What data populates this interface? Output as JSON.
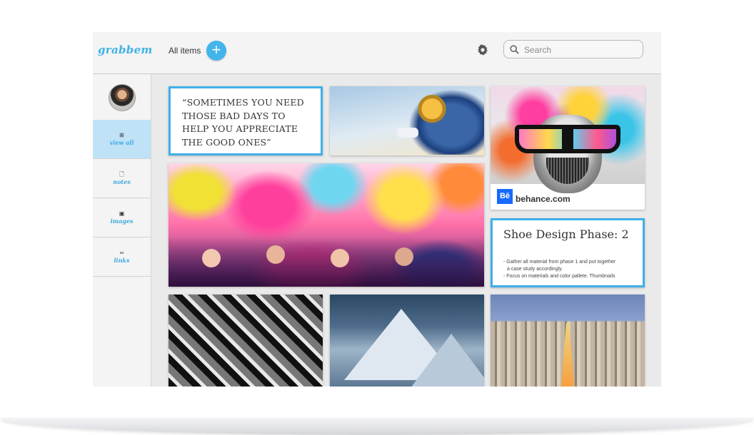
{
  "app": {
    "logo": "grabbem",
    "view_title": "All items",
    "add_button_label": "+",
    "accent_color": "#3eb0ea"
  },
  "search": {
    "placeholder": "Search",
    "value": ""
  },
  "sidebar": {
    "avatar_icon": "user-avatar",
    "items": [
      {
        "label": "view all",
        "icon": "grid-icon",
        "icon_glyph": "⊞",
        "active": true
      },
      {
        "label": "notes",
        "icon": "note-icon",
        "icon_glyph": "🗋",
        "active": false
      },
      {
        "label": "images",
        "icon": "image-icon",
        "icon_glyph": "▣",
        "active": false
      },
      {
        "label": "links",
        "icon": "link-icon",
        "icon_glyph": "∞",
        "active": false
      }
    ]
  },
  "cards": {
    "quote": {
      "text": "“SOMETIMES YOU NEED THOSE  BAD DAYS TO HELP YOU APPRECIATE THE GOOD ONES”"
    },
    "link": {
      "badge": "Bē",
      "domain": "behance.com"
    },
    "note": {
      "title": "Shoe Design Phase: 2",
      "lines": [
        "- Gather all material from phase 1 and put together",
        "a case study accordingly.",
        "- Focus on materials and color pallete. Thumbnails"
      ]
    },
    "images": [
      {
        "name": "astronaut-image"
      },
      {
        "name": "holi-festival-image"
      },
      {
        "name": "geometric-architecture-image"
      },
      {
        "name": "snowy-mountain-image"
      },
      {
        "name": "san-francisco-city-image"
      }
    ]
  }
}
